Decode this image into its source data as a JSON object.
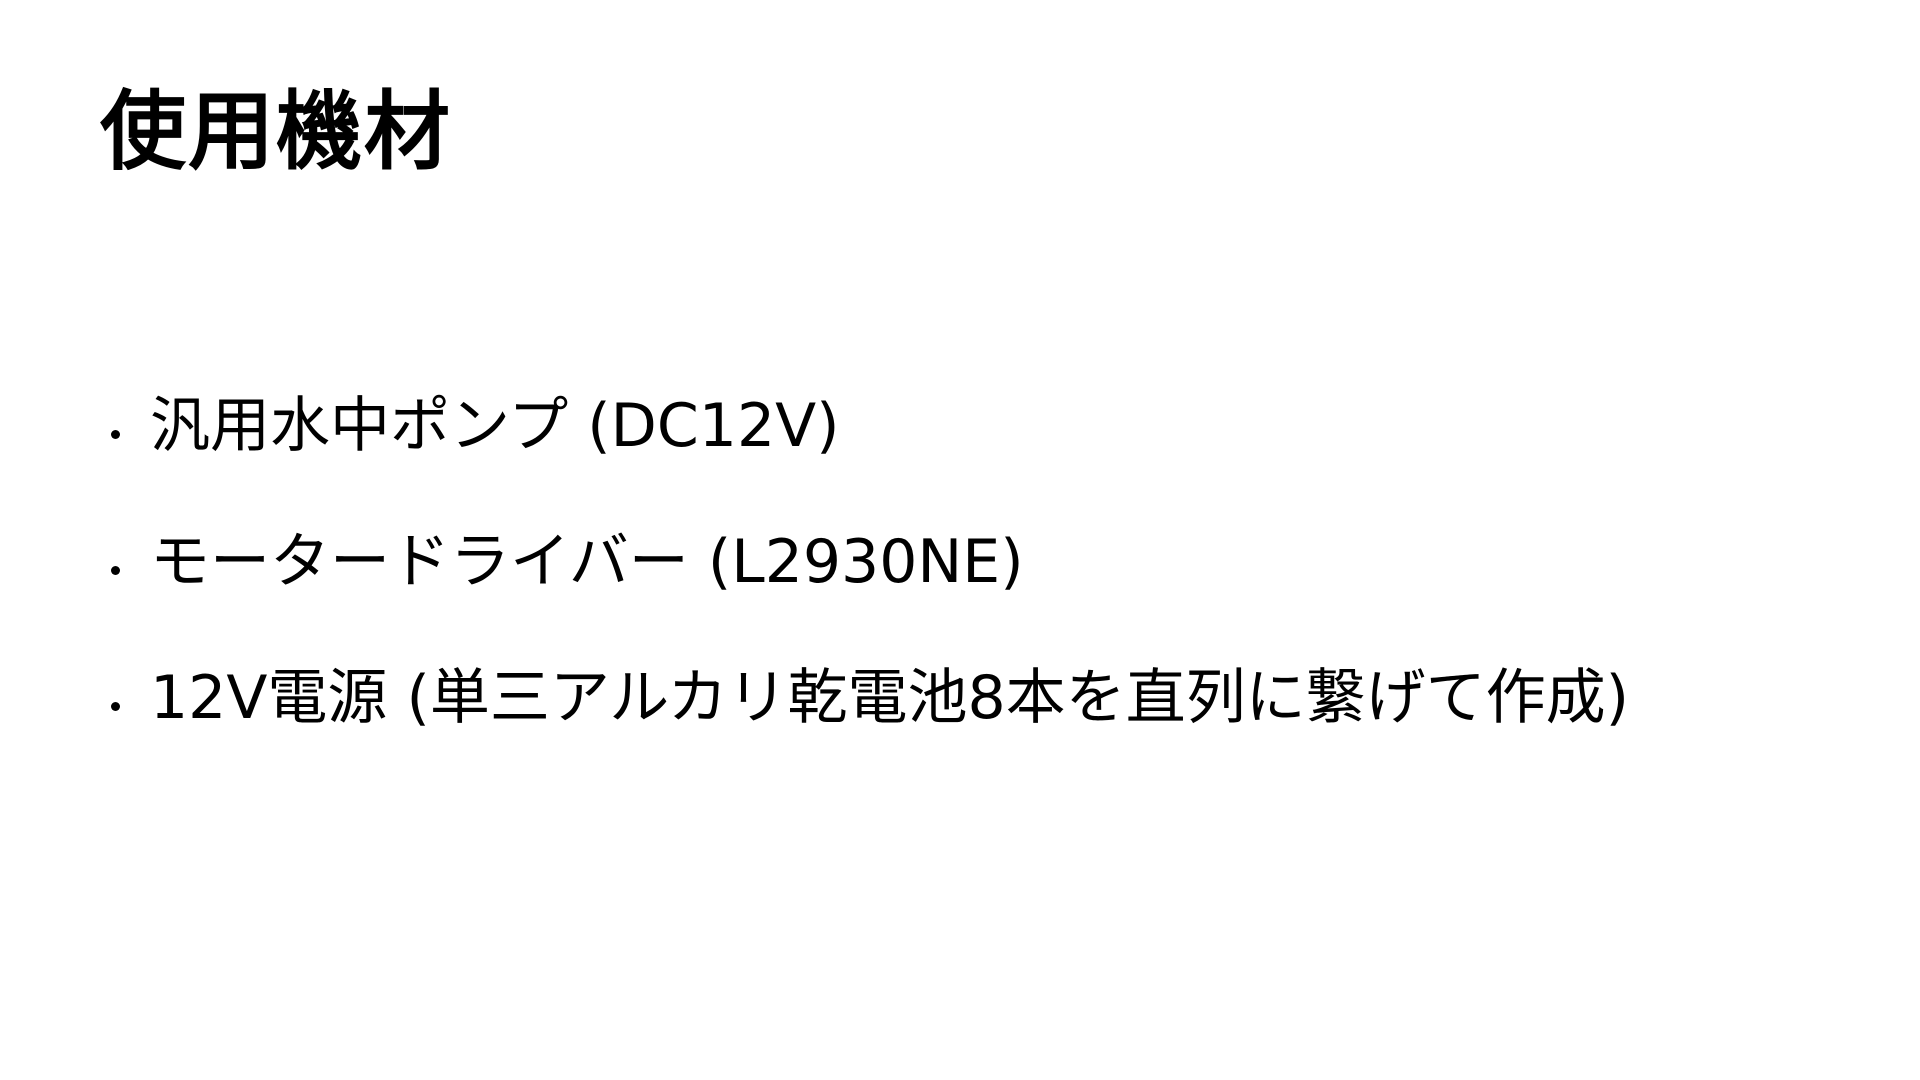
{
  "slide": {
    "title": "使用機材",
    "items": [
      {
        "text": "汎用水中ポンプ (DC12V)"
      },
      {
        "text": "モータードライバー (L2930NE)"
      },
      {
        "text": "12V電源 (単三アルカリ乾電池8本を直列に繋げて作成)"
      }
    ]
  },
  "colors": {
    "background": "#ffffff",
    "text": "#000000"
  }
}
